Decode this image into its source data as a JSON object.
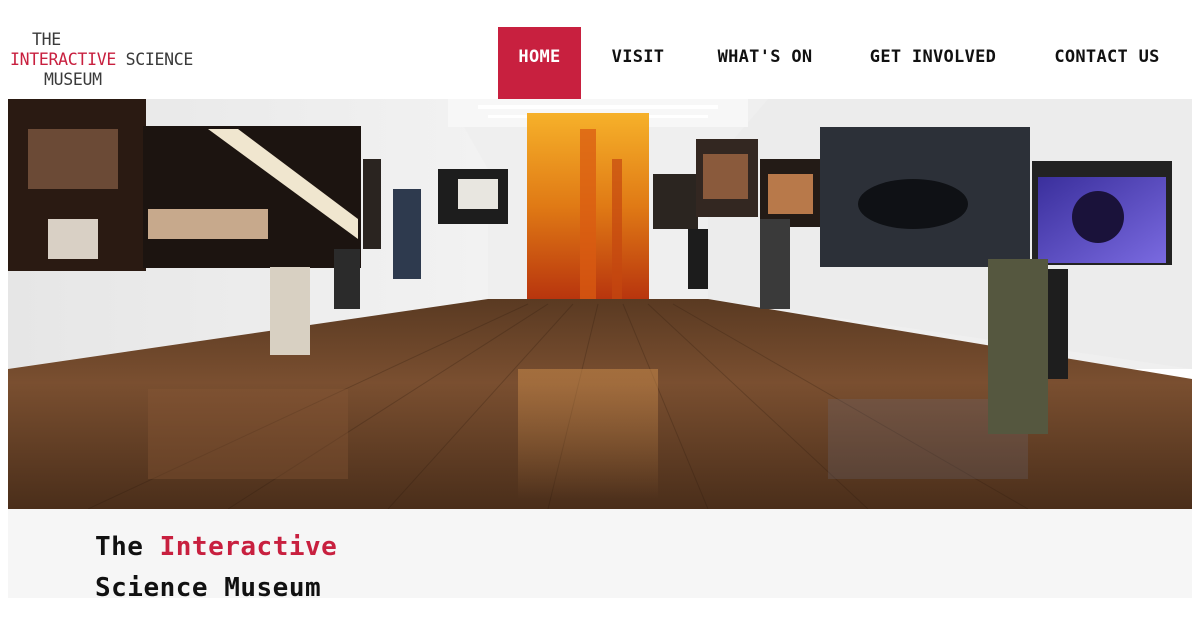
{
  "logo": {
    "line1": "THE",
    "line2_accent": "INTERACTIVE",
    "line2_rest": "SCIENCE",
    "line3": "MUSEUM"
  },
  "nav": {
    "items": [
      {
        "label": "HOME",
        "active": true
      },
      {
        "label": "VISIT",
        "active": false
      },
      {
        "label": "WHAT'S ON",
        "active": false
      },
      {
        "label": "GET INVOLVED",
        "active": false
      },
      {
        "label": "CONTACT US",
        "active": false
      }
    ]
  },
  "hero": {
    "image_description": "Gallery interior with visitors viewing large illuminated photographs"
  },
  "band": {
    "title_prefix": "The",
    "title_accent": "Interactive",
    "title_line2": "Science Museum"
  },
  "colors": {
    "accent": "#c8203f",
    "text": "#111111",
    "band_bg": "#f6f6f6"
  }
}
